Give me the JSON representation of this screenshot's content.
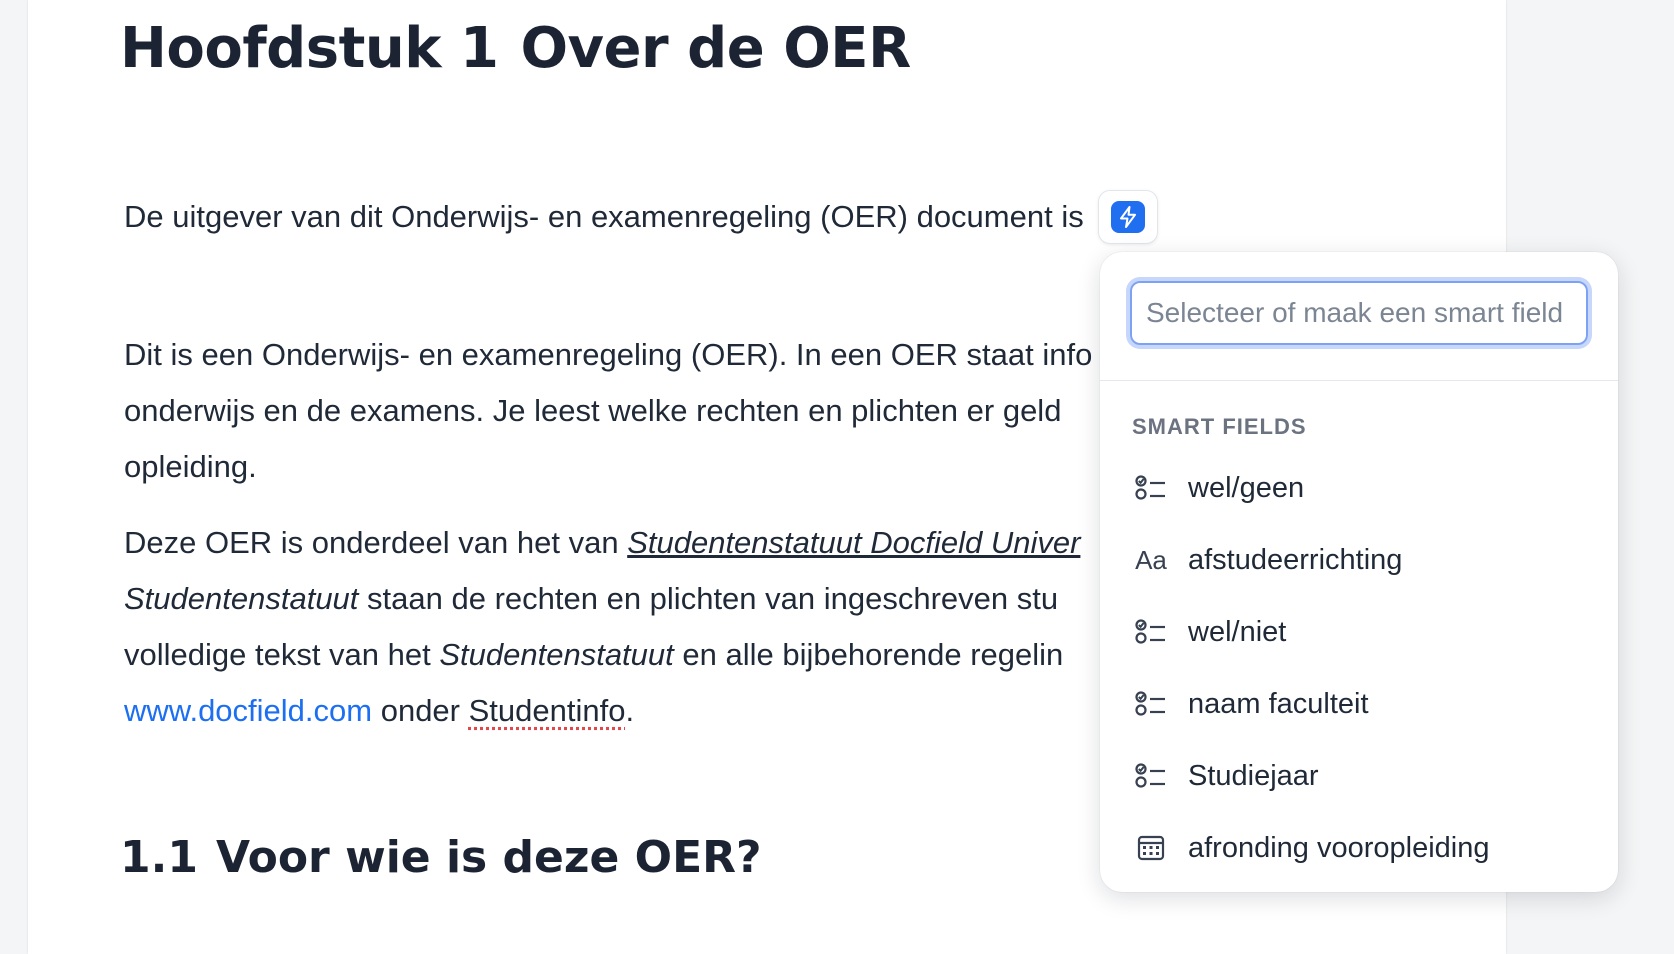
{
  "document": {
    "heading1": {
      "number": "Hoofdstuk 1",
      "title": "Over de OER"
    },
    "intro": "De uitgever van dit Onderwijs- en examenregeling (OER) document is",
    "paragraph2": {
      "line1": "Dit is een Onderwijs- en examenregeling (OER). In een OER staat info",
      "line2": "onderwijs en de examens. Je leest welke rechten en plichten er geld",
      "line3": "opleiding."
    },
    "paragraph3": {
      "line1_prefix": "Deze OER is onderdeel van het van ",
      "line1_link": "Studentenstatuut Docfield Univer",
      "line2_italic": "Studentenstatuut",
      "line2_rest": " staan de rechten en plichten van ingeschreven stu",
      "line3_prefix": "volledige tekst van het ",
      "line3_italic": "Studentenstatuut",
      "line3_rest": " en alle bijbehorende regelin",
      "line4_link": "www.docfield.com",
      "line4_middle": " onder ",
      "line4_word": "Studentinfo",
      "line4_end": "."
    },
    "heading2": {
      "number": "1.1",
      "title": "Voor wie is deze OER?"
    }
  },
  "smart_field_button": {
    "icon": "lightning-bolt-icon",
    "color": "#1f6ff0"
  },
  "dropdown": {
    "search_placeholder": "Selecteer of maak een smart field",
    "section_label": "SMART FIELDS",
    "items": [
      {
        "icon": "checklist-icon",
        "label": "wel/geen"
      },
      {
        "icon": "text-icon",
        "icon_text": "Aa",
        "label": "afstudeerrichting"
      },
      {
        "icon": "checklist-icon",
        "label": "wel/niet"
      },
      {
        "icon": "checklist-icon",
        "label": "naam faculteit"
      },
      {
        "icon": "checklist-icon",
        "label": "Studiejaar"
      },
      {
        "icon": "calendar-icon",
        "label": "afronding vooropleiding"
      }
    ]
  },
  "colors": {
    "link": "#1d6ff2",
    "heading": "#1c2434",
    "accent": "#1f6ff0"
  }
}
